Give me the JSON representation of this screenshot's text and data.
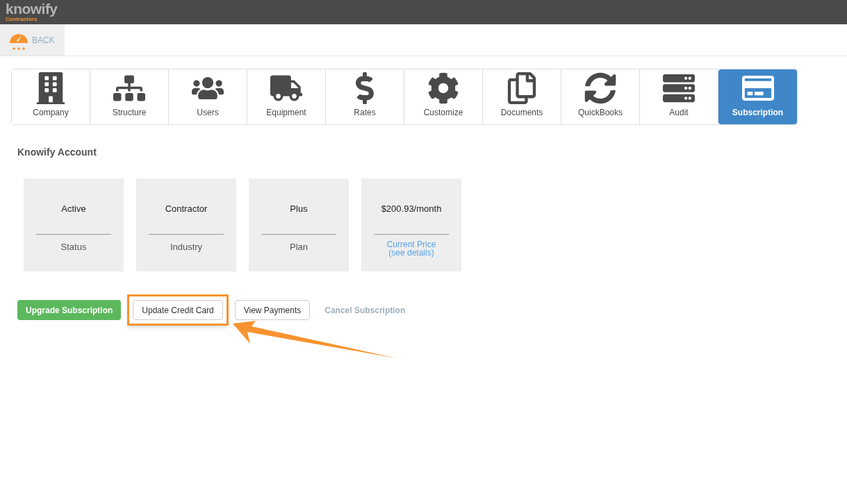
{
  "logo": {
    "name": "knowify",
    "tagline": "Contractors"
  },
  "back": {
    "label": "BACK"
  },
  "tabs": [
    {
      "label": "Company",
      "selected": false
    },
    {
      "label": "Structure",
      "selected": false
    },
    {
      "label": "Users",
      "selected": false
    },
    {
      "label": "Equipment",
      "selected": false
    },
    {
      "label": "Rates",
      "selected": false
    },
    {
      "label": "Customize",
      "selected": false
    },
    {
      "label": "Documents",
      "selected": false
    },
    {
      "label": "QuickBooks",
      "selected": false
    },
    {
      "label": "Audit",
      "selected": false
    },
    {
      "label": "Subscription",
      "selected": true
    }
  ],
  "section_title": "Knowify Account",
  "cards": [
    {
      "value": "Active",
      "label": "Status",
      "kind": "text"
    },
    {
      "value": "Contractor",
      "label": "Industry",
      "kind": "text"
    },
    {
      "value": "Plus",
      "label": "Plan",
      "kind": "text"
    },
    {
      "value": "$200.93/month",
      "label": "Current Price",
      "detail": "(see details)",
      "kind": "link"
    }
  ],
  "actions": [
    {
      "label": "Upgrade Subscription",
      "kind": "primary",
      "highlighted": false
    },
    {
      "label": "Update Credit Card",
      "kind": "default",
      "highlighted": true
    },
    {
      "label": "View Payments",
      "kind": "default",
      "highlighted": false
    },
    {
      "label": "Cancel Subscription",
      "kind": "link",
      "highlighted": false
    }
  ]
}
